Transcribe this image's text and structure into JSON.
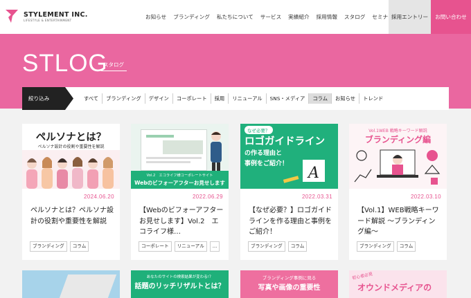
{
  "header": {
    "logo_text": "STYLEMENT INC.",
    "logo_sub": "LIFESTYLE & ENTERTAINMENT",
    "nav": [
      "お知らせ",
      "ブランディング",
      "私たちについて",
      "サービス",
      "実績紹介",
      "採用情報",
      "スタログ",
      "セミナー"
    ],
    "entry_label": "採用エントリー",
    "contact_label": "お問い合わせ"
  },
  "hero": {
    "title": "STLOG",
    "subtitle": "スタログ"
  },
  "filter": {
    "label": "絞り込み",
    "items": [
      "すべて",
      "ブランディング",
      "デザイン",
      "コーポレート",
      "採用",
      "リニューアル",
      "SNS・メディア",
      "コラム",
      "お知らせ",
      "トレンド"
    ],
    "active_index": 7
  },
  "cards": [
    {
      "date": "2024.06.20",
      "title": "ペルソナとは？ペルソナ設計の役割や重要性を解説",
      "tags": [
        "ブランディング",
        "コラム"
      ],
      "img_heading": "ペルソナとは？",
      "img_sub": "ペルソナ設計の役割や重要性を解説"
    },
    {
      "date": "2022.06.29",
      "title": "【Webのビフォーアフターお見せします】Vol.2　エコライフ様…",
      "tags": [
        "コーポレート",
        "リニューアル",
        "…"
      ],
      "img_line1": "Vol.2　エコライフ様コーポレートサイト",
      "img_line2": "Webのビフォーアフターお見せします"
    },
    {
      "date": "2022.03.31",
      "title": "【なぜ必要？】ロゴガイドラインを作る理由と事例をご紹介！",
      "tags": [
        "ブランディング",
        "コラム"
      ],
      "img_badge": "なぜ必要？",
      "img_heading": "ロゴガイドライン",
      "img_sub1": "の作る理由と",
      "img_sub2": "事例をご紹介！"
    },
    {
      "date": "2022.03.10",
      "title": "【Vol.1】WEB戦略キーワード解説 〜ブランディング編〜",
      "tags": [
        "ブランディング",
        "コラム"
      ],
      "img_top": "Vol.1WEB 戦略キーワード解説",
      "img_heading": "ブランディング編"
    }
  ],
  "cards_row2": [
    {
      "img_text": ""
    },
    {
      "img_small": "あなたのサイトの検索結果が変わる!？",
      "img_heading": "話題のリッチリザルトとは？"
    },
    {
      "img_small": "ブランディング事例に見る",
      "img_heading": "写真や画像の重要性"
    },
    {
      "img_badge": "初心者必見",
      "img_heading": "オウンドメディアの"
    }
  ],
  "colors": {
    "brand_pink": "#e7538f",
    "hero_pink": "#ea67a0",
    "card2_green": "#1fb07a",
    "card3_green": "#20b07c"
  }
}
